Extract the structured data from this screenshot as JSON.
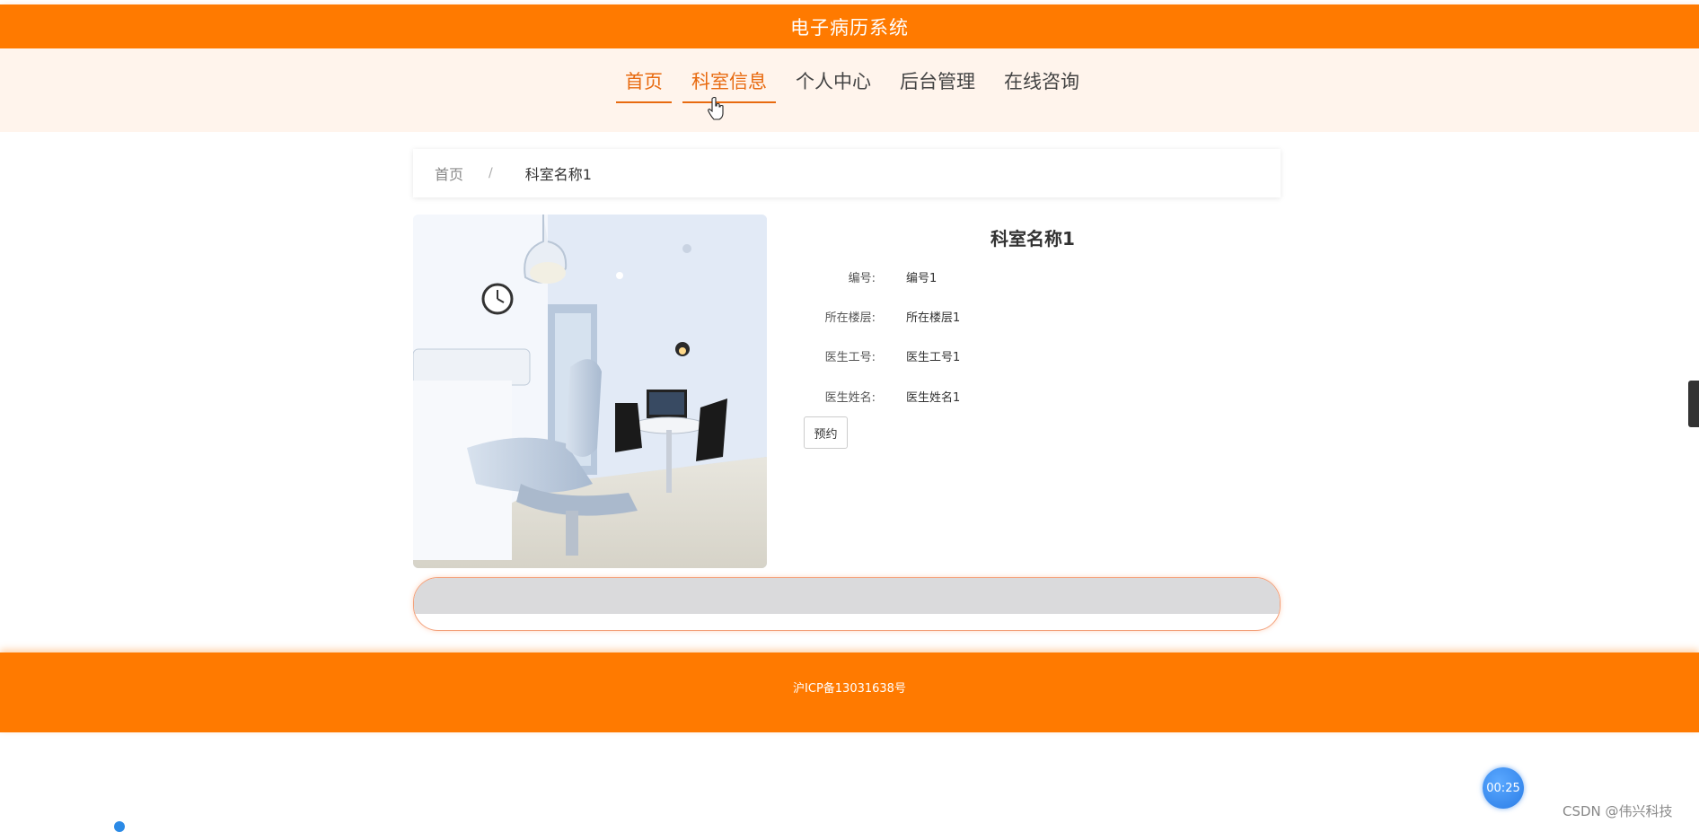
{
  "header": {
    "site_title": "电子病历系统"
  },
  "nav": {
    "items": [
      {
        "label": "首页",
        "active": true
      },
      {
        "label": "科室信息",
        "active": true
      },
      {
        "label": "个人中心",
        "active": false
      },
      {
        "label": "后台管理",
        "active": false
      },
      {
        "label": "在线咨询",
        "active": false
      }
    ]
  },
  "breadcrumb": {
    "home": "首页",
    "separator": "/",
    "current": "科室名称1"
  },
  "detail": {
    "title": "科室名称1",
    "fields": [
      {
        "label": "编号:",
        "value": "编号1"
      },
      {
        "label": "所在楼层:",
        "value": "所在楼层1"
      },
      {
        "label": "医生工号:",
        "value": "医生工号1"
      },
      {
        "label": "医生姓名:",
        "value": "医生姓名1"
      }
    ],
    "book_button": "预约"
  },
  "footer": {
    "icp": "沪ICP备13031638号"
  },
  "overlay": {
    "timer": "00:25",
    "watermark": "CSDN @伟兴科技"
  },
  "colors": {
    "brand": "#ff7a00",
    "accent": "#e86a10"
  }
}
